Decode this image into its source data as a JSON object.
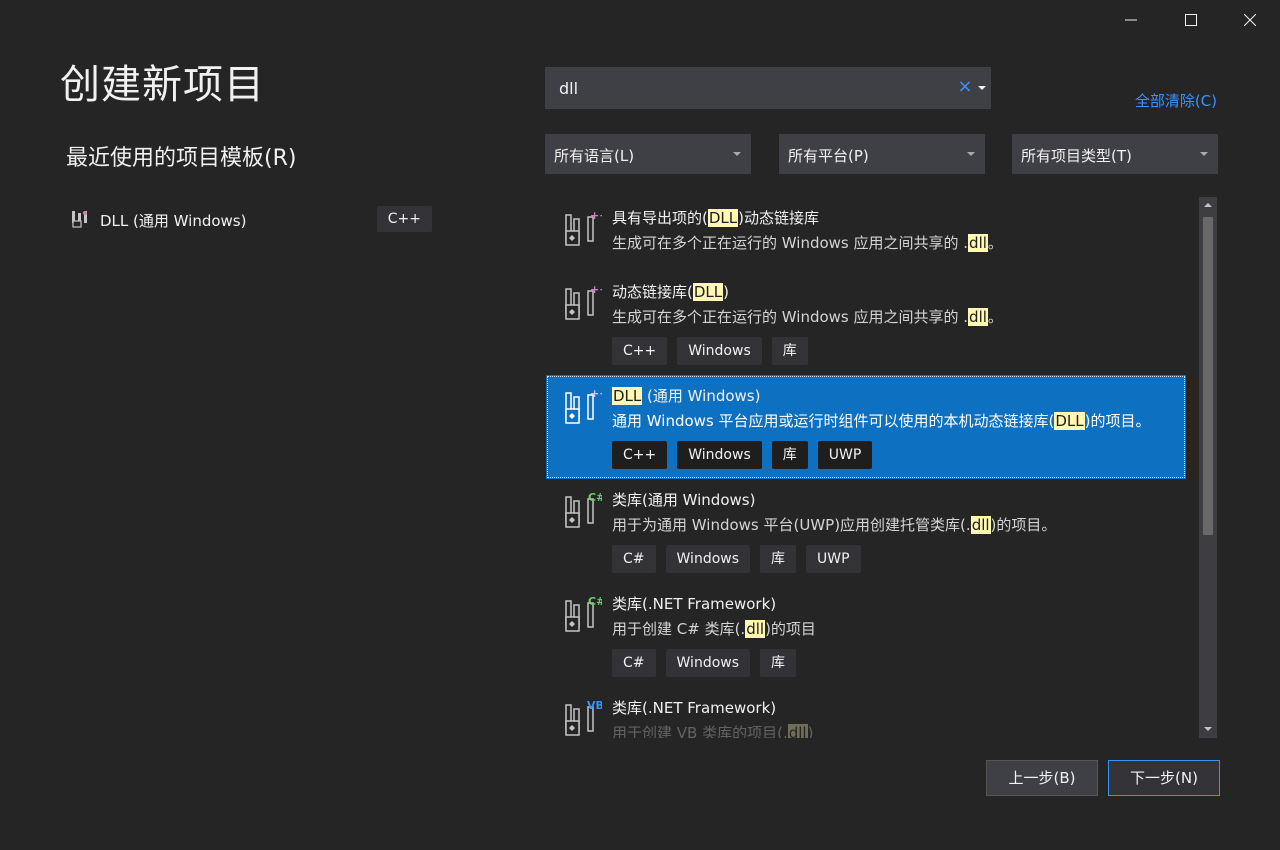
{
  "window": {
    "minimize_icon": "minimize-icon",
    "maximize_icon": "maximize-icon",
    "close_icon": "close-icon"
  },
  "page": {
    "title": "创建新项目"
  },
  "recent": {
    "title": "最近使用的项目模板(R)",
    "items": [
      {
        "label": "DLL (通用 Windows)",
        "tag": "C++",
        "icon": "dll-project-icon"
      }
    ]
  },
  "search": {
    "value": "dll",
    "placeholder": "",
    "clear_icon": "×"
  },
  "clear_all": "全部清除(C)",
  "filters": {
    "language": "所有语言(L)",
    "platform": "所有平台(P)",
    "project_type": "所有项目类型(T)"
  },
  "templates": [
    {
      "name_pre": "具有导出项的(",
      "name_hl": "DLL",
      "name_post": ")动态链接库",
      "desc_pre": "生成可在多个正在运行的 Windows 应用之间共享的 .",
      "desc_hl": "dll",
      "desc_post": "。",
      "tags": [],
      "badge": "++",
      "badge_color": "#c586c0",
      "selected": false
    },
    {
      "name_pre": "动态链接库(",
      "name_hl": "DLL",
      "name_post": ")",
      "desc_pre": "生成可在多个正在运行的 Windows 应用之间共享的 .",
      "desc_hl": "dll",
      "desc_post": "。",
      "tags": [
        "C++",
        "Windows",
        "库"
      ],
      "badge": "++",
      "badge_color": "#c586c0",
      "selected": false
    },
    {
      "name_pre": "",
      "name_hl": "DLL",
      "name_post": " (通用 Windows)",
      "desc_pre": "通用 Windows 平台应用或运行时组件可以使用的本机动态链接库(",
      "desc_hl": "DLL",
      "desc_post": ")的项目。",
      "tags": [
        "C++",
        "Windows",
        "库",
        "UWP"
      ],
      "badge": "++",
      "badge_color": "#c586c0",
      "selected": true
    },
    {
      "name_pre": "类库(通用 Windows)",
      "name_hl": "",
      "name_post": "",
      "desc_pre": "用于为通用 Windows 平台(UWP)应用创建托管类库(.",
      "desc_hl": "dll",
      "desc_post": ")的项目。",
      "tags": [
        "C#",
        "Windows",
        "库",
        "UWP"
      ],
      "badge": "C#",
      "badge_color": "#6ccb6c",
      "selected": false
    },
    {
      "name_pre": "类库(.NET Framework)",
      "name_hl": "",
      "name_post": "",
      "desc_pre": "用于创建 C# 类库(.",
      "desc_hl": "dll",
      "desc_post": ")的项目",
      "tags": [
        "C#",
        "Windows",
        "库"
      ],
      "badge": "C#",
      "badge_color": "#6ccb6c",
      "selected": false
    },
    {
      "name_pre": "类库(.NET Framework)",
      "name_hl": "",
      "name_post": "",
      "desc_pre": "用于创建 VB 类库的项目(.",
      "desc_hl": "dll",
      "desc_post": ")",
      "tags": [],
      "badge": "VB",
      "badge_color": "#3794ff",
      "selected": false
    }
  ],
  "buttons": {
    "back": "上一步(B)",
    "next": "下一步(N)"
  },
  "colors": {
    "accent": "#3794ff",
    "selection": "#0e70c0",
    "highlight": "#fff7b2",
    "background": "#252526"
  }
}
